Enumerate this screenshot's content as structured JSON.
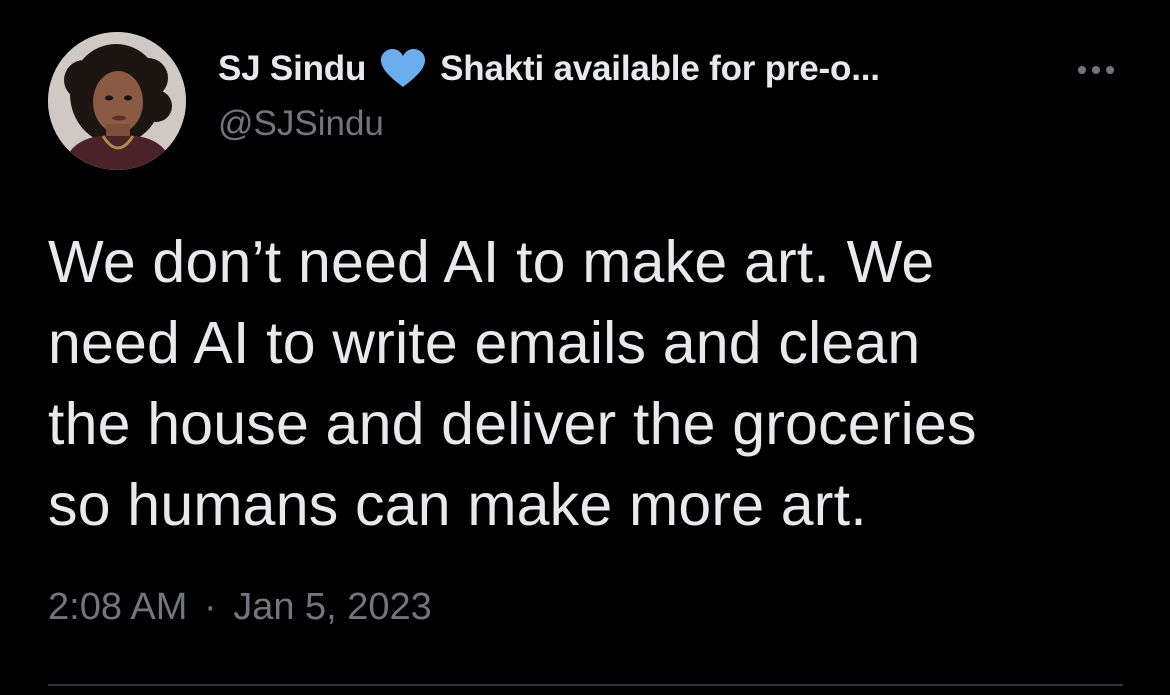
{
  "tweet": {
    "author": {
      "display_name": "SJ Sindu",
      "badge_icon": "blue-heart-icon",
      "bio_snippet": "Shakti available for pre-o...",
      "handle": "@SJSindu"
    },
    "text_lines": [
      "We don’t need AI to make art. We",
      "need AI to write emails and clean",
      "the house and deliver the groceries",
      "so humans can make more art."
    ],
    "time": "2:08 AM",
    "separator": "·",
    "date": "Jan 5, 2023",
    "more_icon": "more-options-icon"
  },
  "colors": {
    "background": "#000000",
    "primary_text": "#e7e9ea",
    "secondary_text": "#71767b",
    "heart": "#6aaef0",
    "divider": "#2f3336"
  }
}
